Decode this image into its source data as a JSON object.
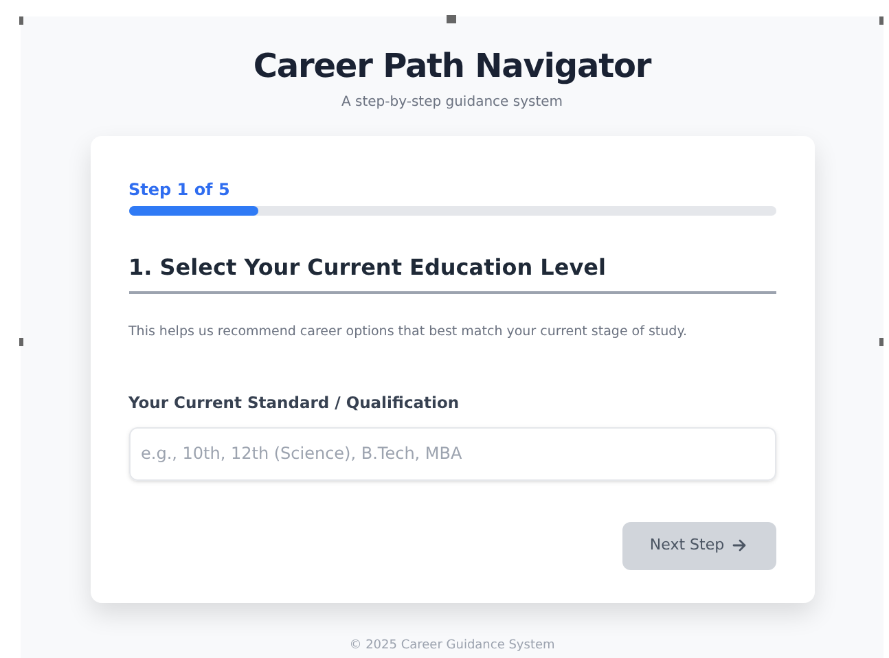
{
  "header": {
    "title": "Career Path Navigator",
    "subtitle": "A step-by-step guidance system"
  },
  "progress": {
    "label": "Step 1 of 5",
    "level": 0.2
  },
  "section": {
    "heading": "1. Select Your Current Education Level",
    "description": "This helps us recommend career options that best match your current stage of study."
  },
  "field": {
    "label": "Your Current Standard / Qualification",
    "placeholder": "e.g., 10th, 12th (Science), B.Tech, MBA"
  },
  "next_button": {
    "label": "Next Step",
    "disabled": true
  },
  "footer": "© 2025 Career Guidance System"
}
